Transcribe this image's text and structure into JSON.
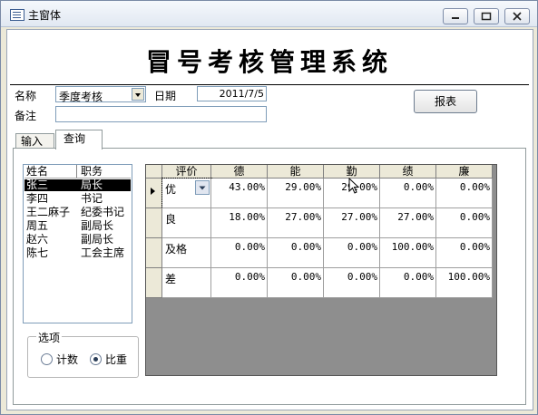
{
  "window": {
    "title": "主窗体"
  },
  "header": {
    "title": "冒号考核管理系统"
  },
  "form": {
    "name_label": "名称",
    "name_value": "季度考核",
    "date_label": "日期",
    "date_value": "2011/7/5",
    "note_label": "备注",
    "note_value": "",
    "report_button": "报表"
  },
  "tabs": [
    {
      "label": "输入"
    },
    {
      "label": "查询"
    }
  ],
  "list": {
    "headers": [
      "姓名",
      "职务"
    ],
    "rows": [
      {
        "name": "张三",
        "title": "局长"
      },
      {
        "name": "李四",
        "title": "书记"
      },
      {
        "name": "王二麻子",
        "title": "纪委书记"
      },
      {
        "name": "周五",
        "title": "副局长"
      },
      {
        "name": "赵六",
        "title": "副局长"
      },
      {
        "name": "陈七",
        "title": "工会主席"
      }
    ]
  },
  "options": {
    "label": "选项",
    "items": [
      {
        "label": "计数",
        "selected": false
      },
      {
        "label": "比重",
        "selected": true
      }
    ]
  },
  "grid": {
    "headers": [
      "评价",
      "德",
      "能",
      "勤",
      "绩",
      "廉"
    ],
    "rows": [
      {
        "rating": "优",
        "values": [
          "43.00%",
          "29.00%",
          "29.00%",
          "0.00%",
          "0.00%"
        ]
      },
      {
        "rating": "良",
        "values": [
          "18.00%",
          "27.00%",
          "27.00%",
          "27.00%",
          "0.00%"
        ]
      },
      {
        "rating": "及格",
        "values": [
          "0.00%",
          "0.00%",
          "0.00%",
          "100.00%",
          "0.00%"
        ]
      },
      {
        "rating": "差",
        "values": [
          "0.00%",
          "0.00%",
          "0.00%",
          "0.00%",
          "100.00%"
        ]
      }
    ]
  }
}
